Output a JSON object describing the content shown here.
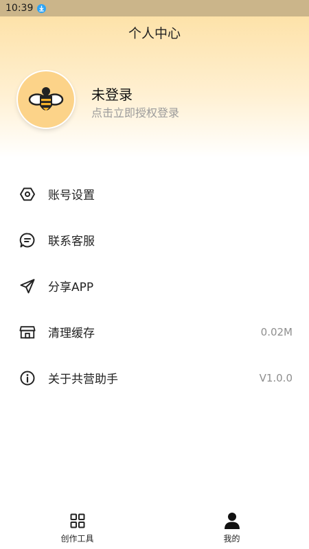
{
  "status_bar": {
    "time": "10:39",
    "download_icon": "download-notification-icon"
  },
  "header": {
    "title": "个人中心"
  },
  "profile": {
    "name": "未登录",
    "subtitle": "点击立即授权登录",
    "avatar_icon": "bee-icon"
  },
  "menu": [
    {
      "label": "账号设置",
      "value": "",
      "icon": "hexagon-settings-icon"
    },
    {
      "label": "联系客服",
      "value": "",
      "icon": "chat-bubble-icon"
    },
    {
      "label": "分享APP",
      "value": "",
      "icon": "paper-plane-icon"
    },
    {
      "label": "清理缓存",
      "value": "0.02M",
      "icon": "store-icon"
    },
    {
      "label": "关于共营助手",
      "value": "V1.0.0",
      "icon": "info-icon"
    }
  ],
  "tab_bar": {
    "tabs": [
      {
        "label": "创作工具",
        "icon": "grid-icon"
      },
      {
        "label": "我的",
        "icon": "person-icon"
      }
    ]
  },
  "colors": {
    "status_bar": "#cbb58a",
    "header_gradient_top": "#fde2a9",
    "avatar_bg": "#fcd389",
    "secondary_text": "#9b9b9b"
  }
}
